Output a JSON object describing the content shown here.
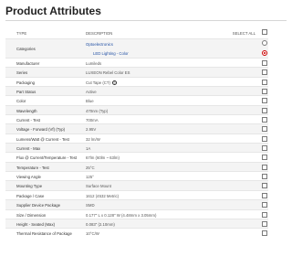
{
  "page": {
    "title": "Product Attributes"
  },
  "table": {
    "col_type": "TYPE",
    "col_description": "DESCRIPTION",
    "col_select_all": "SELECT ALL",
    "categories": {
      "label": "Categories",
      "value1": "Optoelectronics",
      "value2": "LED Lighting - Color"
    },
    "rows": [
      {
        "label": "Manufacturer",
        "value": "Lumileds"
      },
      {
        "label": "Series",
        "value": "LUXEON Rebel Color ES"
      },
      {
        "label": "Packaging",
        "value": "Cut Tape (CT)",
        "icon": "help-icon",
        "icon_glyph": "?"
      },
      {
        "label": "Part Status",
        "value": "Active"
      },
      {
        "label": "Color",
        "value": "Blue"
      },
      {
        "label": "Wavelength",
        "value": "470nm (Typ)"
      },
      {
        "label": "Current - Test",
        "value": "700mA"
      },
      {
        "label": "Voltage - Forward (Vf) (Typ)",
        "value": "2.95V"
      },
      {
        "label": "Lumens/Watt @ Current - Test",
        "value": "32 lm/W"
      },
      {
        "label": "Current - Max",
        "value": "1A"
      },
      {
        "label": "Flux @ Current/Temperature - Test",
        "value": "67lm (60lm ~ 63lm)"
      },
      {
        "label": "Temperature - Test",
        "value": "25°C"
      },
      {
        "label": "Viewing Angle",
        "value": "125°"
      },
      {
        "label": "Mounting Type",
        "value": "Surface Mount"
      },
      {
        "label": "Package / Case",
        "value": "1612 (4532 Metric)"
      },
      {
        "label": "Supplier Device Package",
        "value": "SMD"
      },
      {
        "label": "Size / Dimension",
        "value": "0.177\" L x 0.128\" W (4.48mm x 3.05mm)"
      },
      {
        "label": "Height - Seated (Max)",
        "value": "0.083\" (2.10mm)"
      },
      {
        "label": "Thermal Resistance of Package",
        "value": "10°C/W"
      }
    ]
  }
}
